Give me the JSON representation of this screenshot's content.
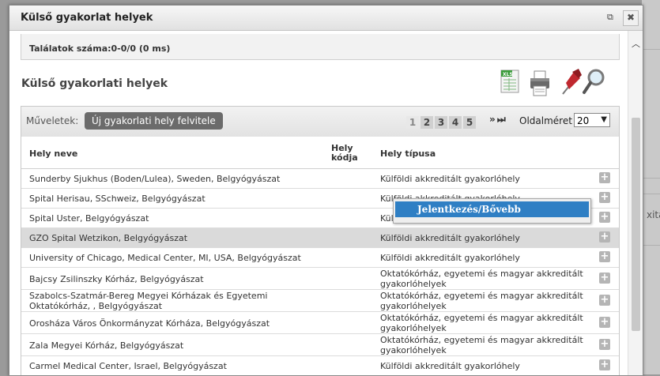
{
  "modal": {
    "title": "Külső gyakorlat helyek"
  },
  "results": {
    "text": "Találatok száma:0-0/0 (0 ms)"
  },
  "section": {
    "title": "Külső gyakorlati helyek"
  },
  "toolbar": {
    "ops_label": "Műveletek:",
    "new_button": "Új gyakorlati hely felvitele",
    "pages": [
      "1",
      "2",
      "3",
      "4",
      "5"
    ],
    "current_page": "1",
    "next_label": "» ⏭",
    "page_size_label": "Oldalméret",
    "page_size_value": "20"
  },
  "table": {
    "headers": {
      "name": "Hely neve",
      "code": "Hely kódja",
      "type": "Hely típusa"
    },
    "rows": [
      {
        "name": "Sunderby Sjukhus (Boden/Lulea), Sweden, Belgyógyászat",
        "type": "Külföldi akkreditált gyakorlóhely"
      },
      {
        "name": "Spital Herisau, SSchweiz, Belgyógyászat",
        "type": "Külföldi akkreditált gyakorlóhely"
      },
      {
        "name": "Spital Uster, Belgyógyászat",
        "type": "Kül"
      },
      {
        "name": "GZO Spital Wetzikon, Belgyógyászat",
        "type": "Külföldi akkreditált gyakorlóhely"
      },
      {
        "name": "University of Chicago, Medical Center, MI, USA, Belgyógyászat",
        "type": "Külföldi akkreditált gyakorlóhely"
      },
      {
        "name": "Bajcsy Zsilinszky Kórház, Belgyógyászat",
        "type": "Oktatókórház, egyetemi és magyar akkreditált gyakorlóhelyek"
      },
      {
        "name": "Szabolcs-Szatmár-Bereg Megyei Kórházak és Egyetemi Oktatókórház, , Belgyógyászat",
        "type": "Oktatókórház, egyetemi és magyar akkreditált gyakorlóhelyek"
      },
      {
        "name": "Orosháza Város Önkormányzat Kórháza, Belgyógyászat",
        "type": "Oktatókórház, egyetemi és magyar akkreditált gyakorlóhelyek"
      },
      {
        "name": "Zala Megyei Kórház, Belgyógyászat",
        "type": "Oktatókórház, egyetemi és magyar akkreditált gyakorlóhelyek"
      },
      {
        "name": "Carmel Medical Center, Israel, Belgyógyászat",
        "type": "Külföldi akkreditált gyakorlóhely"
      }
    ]
  },
  "context_menu": {
    "item": "Jelentkezés/Bővebb"
  },
  "icons": {
    "excel": "excel-export-icon",
    "print": "printer-icon",
    "pin": "pin-icon",
    "search": "magnifier-icon"
  },
  "background": {
    "ghost_text": "xitá"
  },
  "colors": {
    "accent": "#2f7fc4",
    "button": "#6b6b6b",
    "selected_row": "#dadada"
  }
}
